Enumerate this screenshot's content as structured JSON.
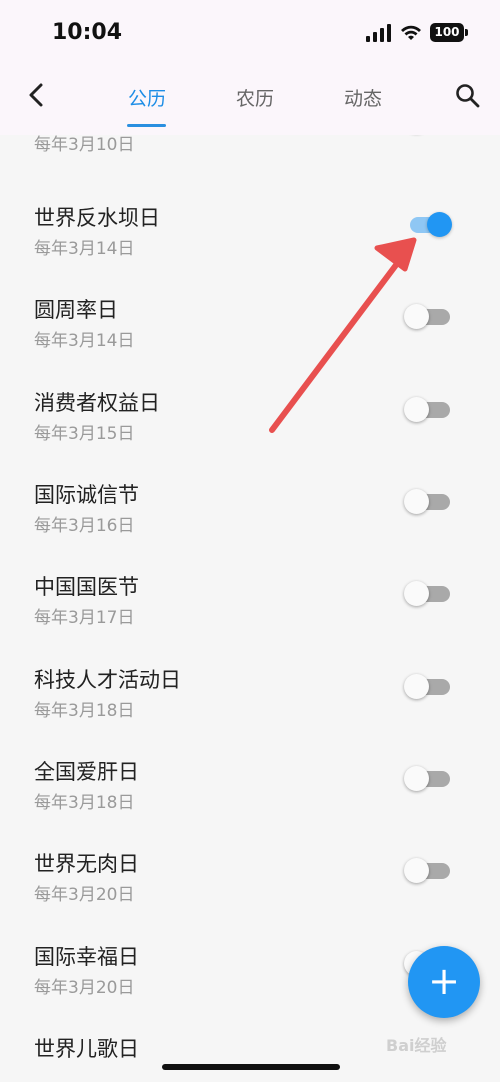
{
  "status_bar": {
    "time": "10:04",
    "battery": "100"
  },
  "nav": {
    "tabs": [
      {
        "label": "公历",
        "active": true
      },
      {
        "label": "农历",
        "active": false
      },
      {
        "label": "动态",
        "active": false
      }
    ]
  },
  "list": {
    "partial_top": {
      "date": "每年3月10日"
    },
    "items": [
      {
        "title": "世界反水坝日",
        "date": "每年3月14日",
        "enabled": true
      },
      {
        "title": "圆周率日",
        "date": "每年3月14日",
        "enabled": false
      },
      {
        "title": "消费者权益日",
        "date": "每年3月15日",
        "enabled": false
      },
      {
        "title": "国际诚信节",
        "date": "每年3月16日",
        "enabled": false
      },
      {
        "title": "中国国医节",
        "date": "每年3月17日",
        "enabled": false
      },
      {
        "title": "科技人才活动日",
        "date": "每年3月18日",
        "enabled": false
      },
      {
        "title": "全国爱肝日",
        "date": "每年3月18日",
        "enabled": false
      },
      {
        "title": "世界无肉日",
        "date": "每年3月20日",
        "enabled": false
      },
      {
        "title": "国际幸福日",
        "date": "每年3月20日",
        "enabled": false
      },
      {
        "title": "世界儿歌日",
        "date": "",
        "enabled": false
      }
    ]
  },
  "fab": {
    "label": "+"
  },
  "colors": {
    "accent": "#2196f3",
    "annotation_arrow": "#e8504f"
  },
  "icons": [
    "back-chevron-icon",
    "search-icon",
    "signal-icon",
    "wifi-icon",
    "battery-icon"
  ],
  "watermark": "Bai经验"
}
